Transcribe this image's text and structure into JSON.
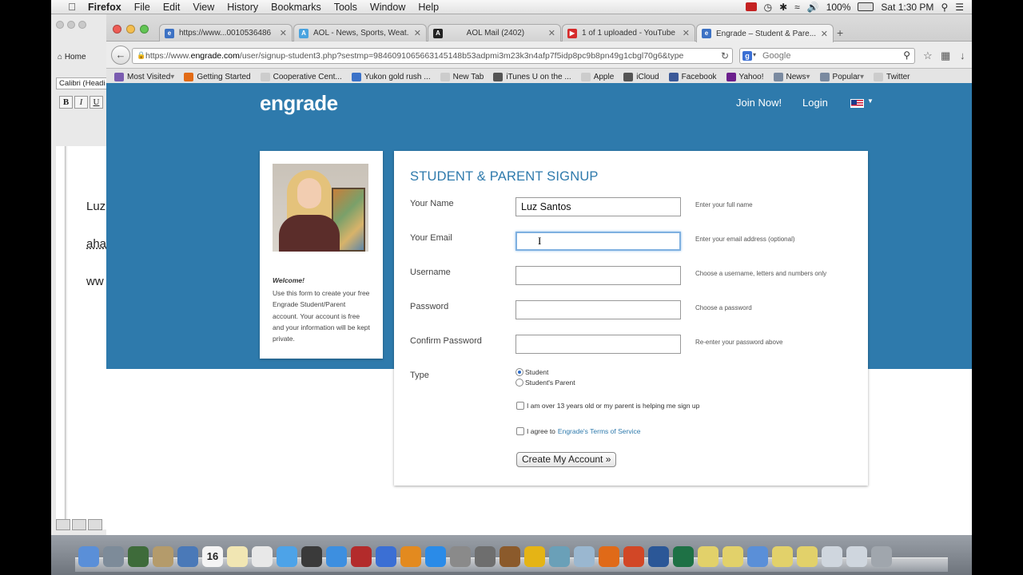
{
  "menubar": {
    "apple": "",
    "items": [
      "Firefox",
      "File",
      "Edit",
      "View",
      "History",
      "Bookmarks",
      "Tools",
      "Window",
      "Help"
    ],
    "battery": "100%",
    "clock": "Sat 1:30 PM",
    "status_icons": [
      "camera-icon",
      "time-machine-icon",
      "bluetooth-icon",
      "wifi-icon",
      "volume-icon",
      "battery-icon",
      "spotlight-icon",
      "notification-icon"
    ]
  },
  "word_window": {
    "home_tab": "Home",
    "font_name": "Calibri (Headi",
    "format_buttons": [
      "B",
      "I",
      "U"
    ],
    "doc_lines": [
      "Luz",
      "aha",
      "ww"
    ]
  },
  "browser": {
    "tabs": [
      {
        "title": "https://www...0010536486",
        "icon": "engrade-icon",
        "color": "#3d72c4"
      },
      {
        "title": "AOL - News, Sports, Weat...",
        "icon": "aol-icon",
        "color": "#4aa3df"
      },
      {
        "title": "AOL Mail (2402)",
        "icon": "aol-mail-icon",
        "color": "#222222"
      },
      {
        "title": "1 of 1 uploaded - YouTube",
        "icon": "youtube-icon",
        "color": "#d62b2b"
      },
      {
        "title": "Engrade – Student & Pare...",
        "icon": "engrade-icon",
        "color": "#3d72c4"
      }
    ],
    "url_prefix": "https://www.",
    "url_host": "engrade.com",
    "url_path": "/user/signup-student3.php?sestmp=9846091065663145148b53adpmi3m23k3n4afp7f5idp8pc9b8pn49g1cbgl70g6&type",
    "search_placeholder": "Google",
    "bookmarks": [
      {
        "label": "Most Visited",
        "icon": "folder-icon",
        "color": "#7a5cb0",
        "caret": true
      },
      {
        "label": "Getting Started",
        "icon": "firefox-icon",
        "color": "#e26b16"
      },
      {
        "label": "Cooperative Cent...",
        "icon": "page-icon",
        "color": "#cccccc"
      },
      {
        "label": "Yukon gold rush ...",
        "icon": "bookmark-icon",
        "color": "#3b72c8"
      },
      {
        "label": "New Tab",
        "icon": "page-icon",
        "color": "#cccccc"
      },
      {
        "label": "iTunes U on the ...",
        "icon": "itunes-icon",
        "color": "#555555"
      },
      {
        "label": "Apple",
        "icon": "page-icon",
        "color": "#cccccc"
      },
      {
        "label": "iCloud",
        "icon": "apple-icon",
        "color": "#555555"
      },
      {
        "label": "Facebook",
        "icon": "facebook-icon",
        "color": "#3b5998"
      },
      {
        "label": "Yahoo!",
        "icon": "yahoo-icon",
        "color": "#6b1f8c"
      },
      {
        "label": "News",
        "icon": "folder-icon",
        "color": "#7a8aa0",
        "caret": true
      },
      {
        "label": "Popular",
        "icon": "folder-icon",
        "color": "#7a8aa0",
        "caret": true
      },
      {
        "label": "Twitter",
        "icon": "page-icon",
        "color": "#cccccc"
      }
    ]
  },
  "site": {
    "logo": "engrade",
    "join": "Join Now!",
    "login": "Login",
    "accent": "#2e7aac"
  },
  "sidecard": {
    "welcome": "Welcome!",
    "desc": "Use this form to create your free Engrade Student/Parent account. Your account is free and your information will be kept private."
  },
  "form": {
    "title": "STUDENT & PARENT SIGNUP",
    "fields": [
      {
        "label": "Your Name",
        "value": "Luz Santos",
        "hint": "Enter your full name"
      },
      {
        "label": "Your Email",
        "value": "",
        "hint": "Enter your email address (optional)"
      },
      {
        "label": "Username",
        "value": "",
        "hint": "Choose a username, letters and numbers only"
      },
      {
        "label": "Password",
        "value": "",
        "hint": "Choose a password"
      },
      {
        "label": "Confirm Password",
        "value": "",
        "hint": "Re-enter your password above"
      }
    ],
    "type_label": "Type",
    "type_options": [
      "Student",
      "Student's Parent"
    ],
    "type_selected": "Student",
    "age_check": "I am over 13 years old or my parent is helping me sign up",
    "terms_prefix": "I agree to",
    "terms_link": "Engrade's Terms of Service",
    "submit": "Create My Account »"
  },
  "dock": {
    "icons": [
      "finder-icon",
      "launchpad-icon",
      "activity-icon",
      "preview-icon",
      "photos-icon",
      "calendar-icon",
      "notes-icon",
      "textedit-icon",
      "messages-icon",
      "facetime-icon",
      "safari-icon",
      "photobooth-icon",
      "itunes-icon",
      "ibooks-icon",
      "appstore-icon",
      "system-prefs-icon",
      "iphoto-icon",
      "garageband-icon",
      "outlook-icon",
      "tools-icon",
      "network-icon",
      "firefox-icon",
      "powerpoint-icon",
      "word-icon",
      "excel-icon",
      "warning-icon",
      "warning-icon",
      "finder-icon",
      "warning-icon",
      "warning-icon",
      "documents-icon",
      "downloads-icon",
      "trash-icon"
    ],
    "calendar_day": "16"
  }
}
